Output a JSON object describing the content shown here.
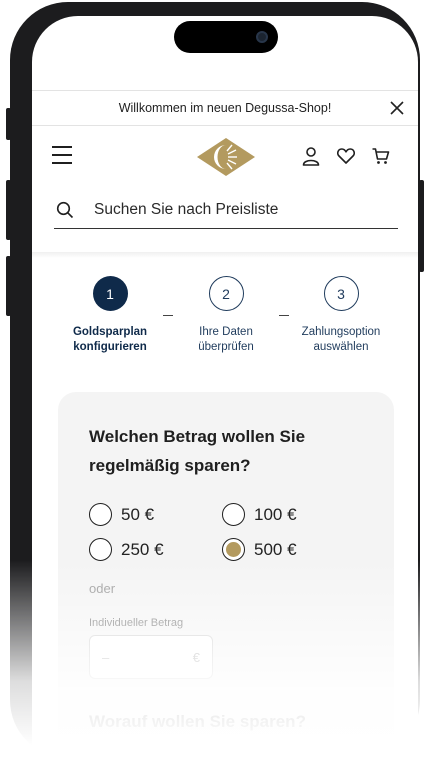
{
  "banner": {
    "text": "Willkommen im neuen Degussa-Shop!"
  },
  "search": {
    "placeholder": "Suchen Sie nach Preisliste"
  },
  "steps": [
    {
      "number": "1",
      "label_line1": "Goldsparplan",
      "label_line2": "konfigurieren",
      "active": true
    },
    {
      "number": "2",
      "label_line1": "Ihre Daten",
      "label_line2": "überprüfen",
      "active": false
    },
    {
      "number": "3",
      "label_line1": "Zahlungsoption",
      "label_line2": "auswählen",
      "active": false
    }
  ],
  "amount_section": {
    "title": "Welchen Betrag wollen Sie regelmäßig sparen?",
    "options": [
      {
        "label": "50 €",
        "selected": false
      },
      {
        "label": "100 €",
        "selected": false
      },
      {
        "label": "250 €",
        "selected": false
      },
      {
        "label": "500 €",
        "selected": true
      }
    ],
    "or_text": "oder",
    "custom_amount_label": "Individueller Betrag",
    "custom_amount_placeholder": "–",
    "currency_symbol": "€"
  },
  "next_question": "Worauf wollen Sie sparen?",
  "colors": {
    "navy": "#0f2a4a",
    "gold": "#b39a5f",
    "card_bg": "#f4f4f4"
  }
}
